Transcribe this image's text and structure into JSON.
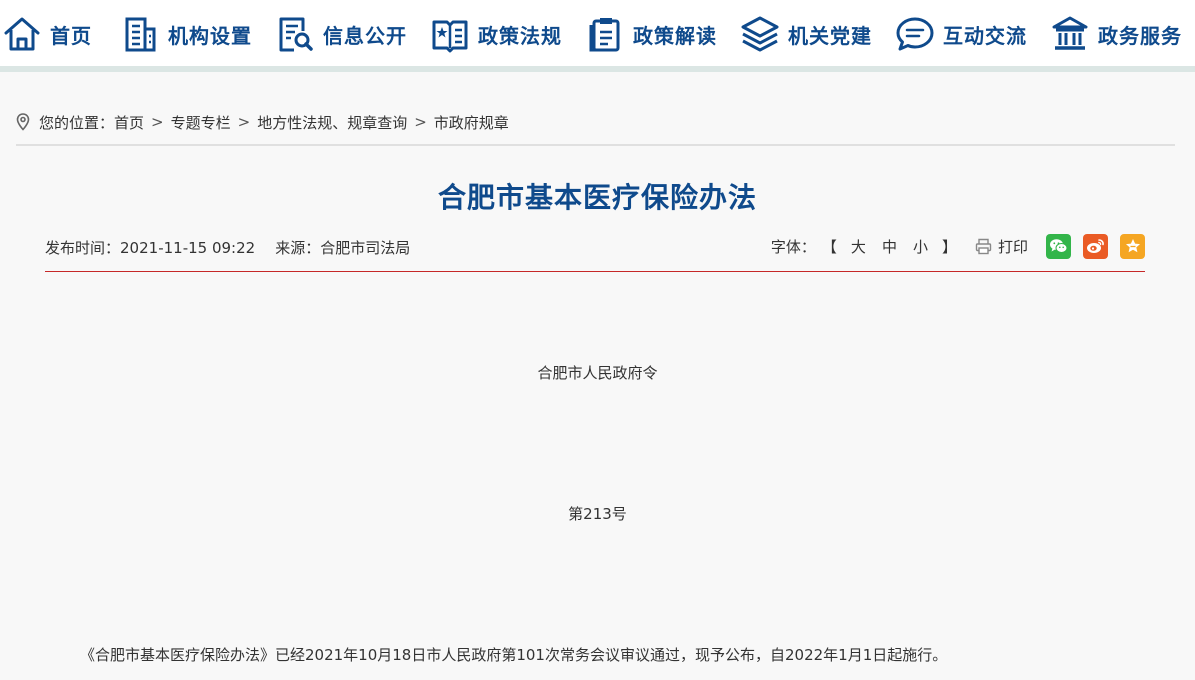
{
  "nav": [
    {
      "label": "首页",
      "icon": "home-icon"
    },
    {
      "label": "机构设置",
      "icon": "building-icon"
    },
    {
      "label": "信息公开",
      "icon": "document-search-icon"
    },
    {
      "label": "政策法规",
      "icon": "book-star-icon"
    },
    {
      "label": "政策解读",
      "icon": "clipboard-icon"
    },
    {
      "label": "机关党建",
      "icon": "layers-icon"
    },
    {
      "label": "互动交流",
      "icon": "chat-bubble-icon"
    },
    {
      "label": "政务服务",
      "icon": "government-building-icon"
    }
  ],
  "breadcrumb": {
    "prefix": "您的位置：",
    "separator": ">",
    "items": [
      "首页",
      "专题专栏",
      "地方性法规、规章查询",
      "市政府规章"
    ]
  },
  "article": {
    "title": "合肥市基本医疗保险办法",
    "publish_label": "发布时间：",
    "publish_time": "2021-11-15 09:22",
    "source_label": "来源：",
    "source": "合肥市司法局",
    "font_label": "字体：",
    "bracket_open": "【",
    "bracket_close": "】",
    "font_sizes": [
      "大",
      "中",
      "小"
    ],
    "print_label": "打印",
    "share": [
      "wechat-icon",
      "weibo-icon",
      "star-icon"
    ],
    "order_issuer": "合肥市人民政府令",
    "order_number": "第213号",
    "body": "《合肥市基本医疗保险办法》已经2021年10月18日市人民政府第101次常务会议审议通过，现予公布，自2022年1月1日起施行。"
  },
  "colors": {
    "nav_text": "#0f4a8c",
    "title": "#0f4a8c",
    "divider": "#c62828",
    "wechat": "#33b54a",
    "weibo": "#ea5b25",
    "favorite": "#f5a623"
  }
}
